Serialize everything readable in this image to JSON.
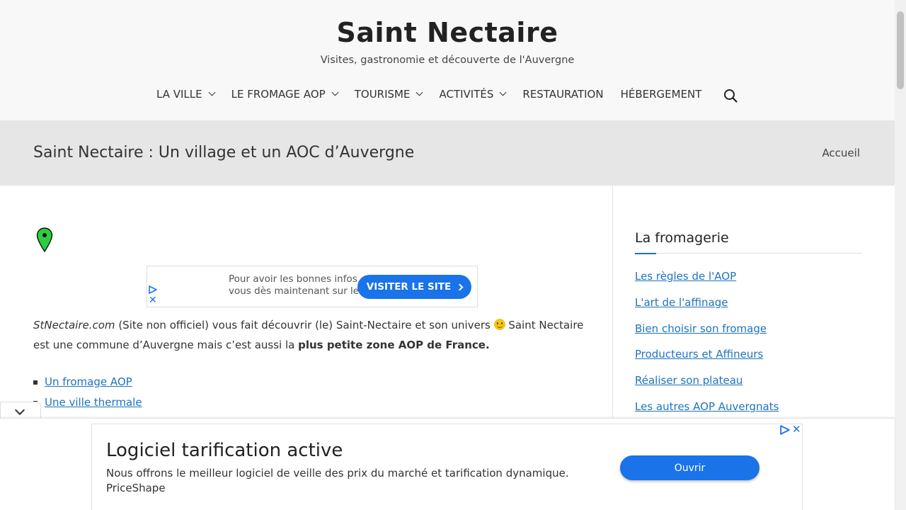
{
  "header": {
    "site_title": "Saint Nectaire",
    "tagline": "Visites, gastronomie et découverte de l'Auvergne"
  },
  "nav": {
    "items": [
      {
        "label": "LA VILLE",
        "has_dropdown": true
      },
      {
        "label": "LE FROMAGE AOP",
        "has_dropdown": true
      },
      {
        "label": "TOURISME",
        "has_dropdown": true
      },
      {
        "label": "ACTIVITÉS",
        "has_dropdown": true
      },
      {
        "label": "RESTAURATION",
        "has_dropdown": false
      },
      {
        "label": "HÉBERGEMENT",
        "has_dropdown": false
      }
    ],
    "search_icon": "search-icon"
  },
  "page": {
    "title": "Saint Nectaire : Un village et un AOC d’Auvergne",
    "breadcrumb_home": "Accueil"
  },
  "inline_ad": {
    "text_line1": "Pour avoir les bonnes infos",
    "text_line2": "vous dès maintenant sur le s",
    "button_label": "VISITER LE SITE",
    "close_symbol": "✕"
  },
  "intro": {
    "site_name": "StNectaire.com",
    "part1": " (Site non officiel) vous fait découvrir (le) Saint-Nectaire et son univers ",
    "part2": " Saint Nectaire est une commune d’Auvergne mais c’est aussi la ",
    "bold": "plus petite zone AOP de France."
  },
  "content_links": [
    "Un fromage AOP",
    "Une ville thermale"
  ],
  "sidebar": {
    "widget_title": "La fromagerie",
    "links": [
      "Les règles de l'AOP",
      "L'art de l'affinage",
      "Bien choisir son fromage",
      "Producteurs et Affineurs",
      "Réaliser son plateau",
      "Les autres AOP Auvergnats"
    ]
  },
  "anchor_ad": {
    "headline": "Logiciel tarification active",
    "description": "Nous offrons le meilleur logiciel de veille des prix du marché et tarification dynamique.",
    "advertiser": "PriceShape",
    "button_label": "Ouvrir",
    "close_symbol": "✕"
  },
  "colors": {
    "link": "#1e73be",
    "ad_button": "#1a73e8",
    "header_bg": "#f8f8f8",
    "title_band_bg": "#e6e6e6",
    "map_pin": "#2ecc40"
  }
}
